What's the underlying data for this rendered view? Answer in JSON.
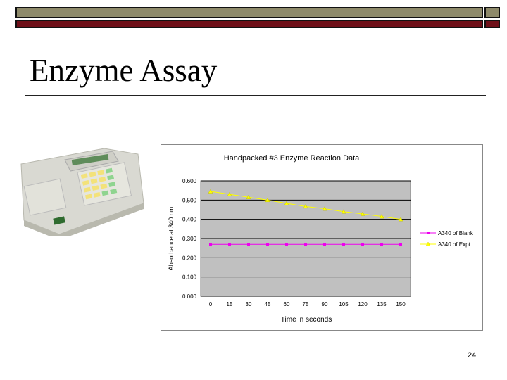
{
  "slide": {
    "title": "Enzyme Assay",
    "page_number": "24"
  },
  "colors": {
    "olive": "#8e8a6a",
    "maroon": "#6e0f18",
    "plot_bg": "#c0c0c0",
    "blank": "#ee00ee",
    "expt": "#ffff00"
  },
  "chart_data": {
    "type": "line",
    "title": "Handpacked #3 Enzyme Reaction Data",
    "xlabel": "Time in seconds",
    "ylabel": "Absorbance at 340 nm",
    "categories": [
      "0",
      "15",
      "30",
      "45",
      "60",
      "75",
      "90",
      "105",
      "120",
      "135",
      "150"
    ],
    "ylim": [
      0,
      0.6
    ],
    "yticks": [
      "0.000",
      "0.100",
      "0.200",
      "0.300",
      "0.400",
      "0.500",
      "0.600"
    ],
    "grid": true,
    "legend_position": "right",
    "series": [
      {
        "name": "A340 of Blank",
        "marker": "square",
        "color": "#ee00ee",
        "values": [
          0.27,
          0.27,
          0.27,
          0.27,
          0.27,
          0.27,
          0.27,
          0.27,
          0.27,
          0.27,
          0.27
        ]
      },
      {
        "name": "A340 of Expt",
        "marker": "triangle",
        "color": "#ffff00",
        "values": [
          0.545,
          0.53,
          0.515,
          0.5,
          0.483,
          0.467,
          0.455,
          0.44,
          0.428,
          0.415,
          0.4
        ]
      }
    ]
  }
}
